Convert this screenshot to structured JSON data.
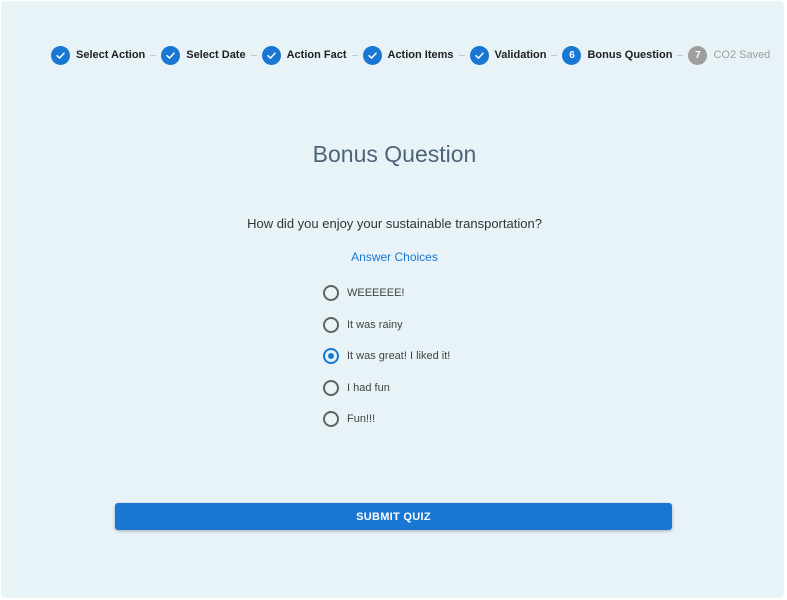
{
  "stepper": {
    "steps": [
      {
        "label": "Select Action",
        "state": "done"
      },
      {
        "label": "Select Date",
        "state": "done"
      },
      {
        "label": "Action Fact",
        "state": "done"
      },
      {
        "label": "Action Items",
        "state": "done"
      },
      {
        "label": "Validation",
        "state": "done"
      },
      {
        "label": "Bonus Question",
        "state": "active",
        "number": "6"
      },
      {
        "label": "CO2 Saved",
        "state": "inactive",
        "number": "7"
      }
    ]
  },
  "main": {
    "title": "Bonus Question",
    "question": "How did you enjoy your sustainable transportation?",
    "choices_label": "Answer Choices",
    "options": [
      {
        "label": "WEEEEEE!",
        "checked": false
      },
      {
        "label": "It was rainy",
        "checked": false
      },
      {
        "label": "It was great! I liked it!",
        "checked": true
      },
      {
        "label": "I had fun",
        "checked": false
      },
      {
        "label": "Fun!!!",
        "checked": false
      }
    ],
    "submit_label": "SUBMIT QUIZ"
  },
  "colors": {
    "accent": "#1976d2",
    "background": "#e8f3f8",
    "inactive": "#9e9e9e",
    "title": "#4d6479"
  }
}
